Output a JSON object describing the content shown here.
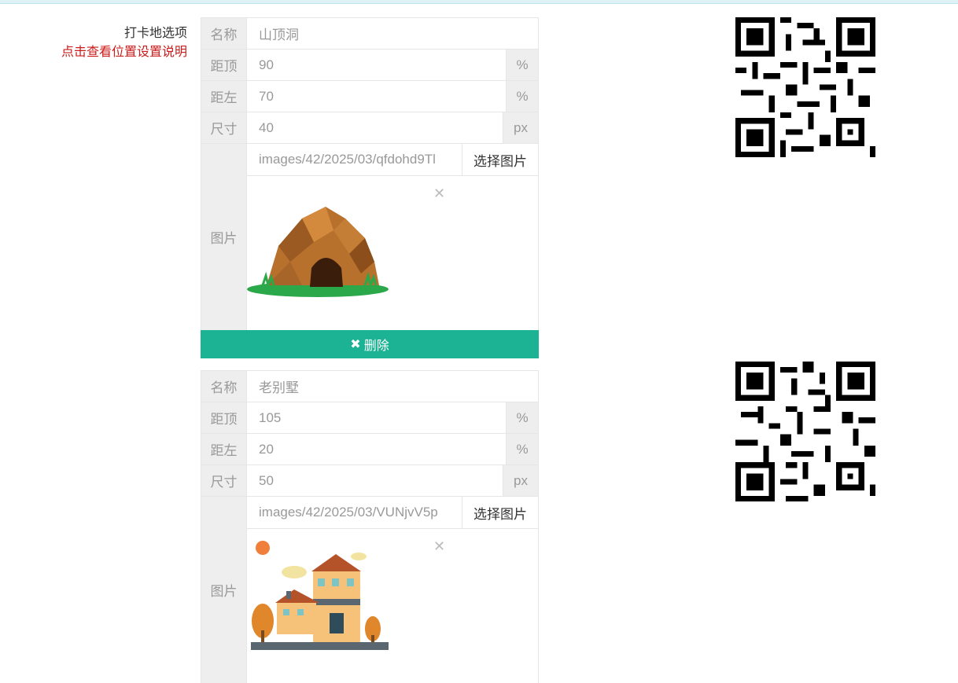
{
  "field": {
    "label": "打卡地选项",
    "help_link": "点击查看位置设置说明"
  },
  "labels": {
    "name": "名称",
    "top": "距顶",
    "left": "距左",
    "size": "尺寸",
    "image": "图片",
    "percent": "%",
    "px": "px",
    "pick_image": "选择图片",
    "delete": "删除"
  },
  "icons": {
    "close": "close-icon",
    "delete": "delete-x-icon"
  },
  "items": [
    {
      "name": "山顶洞",
      "top": "90",
      "left": "70",
      "size": "40",
      "image_path": "images/42/2025/03/qfdohd9Tl",
      "image_kind": "cave"
    },
    {
      "name": "老别墅",
      "top": "105",
      "left": "20",
      "size": "50",
      "image_path": "images/42/2025/03/VUNjvV5p",
      "image_kind": "house"
    }
  ],
  "colors": {
    "accent": "#1bb394",
    "link": "#cc1b1b"
  }
}
